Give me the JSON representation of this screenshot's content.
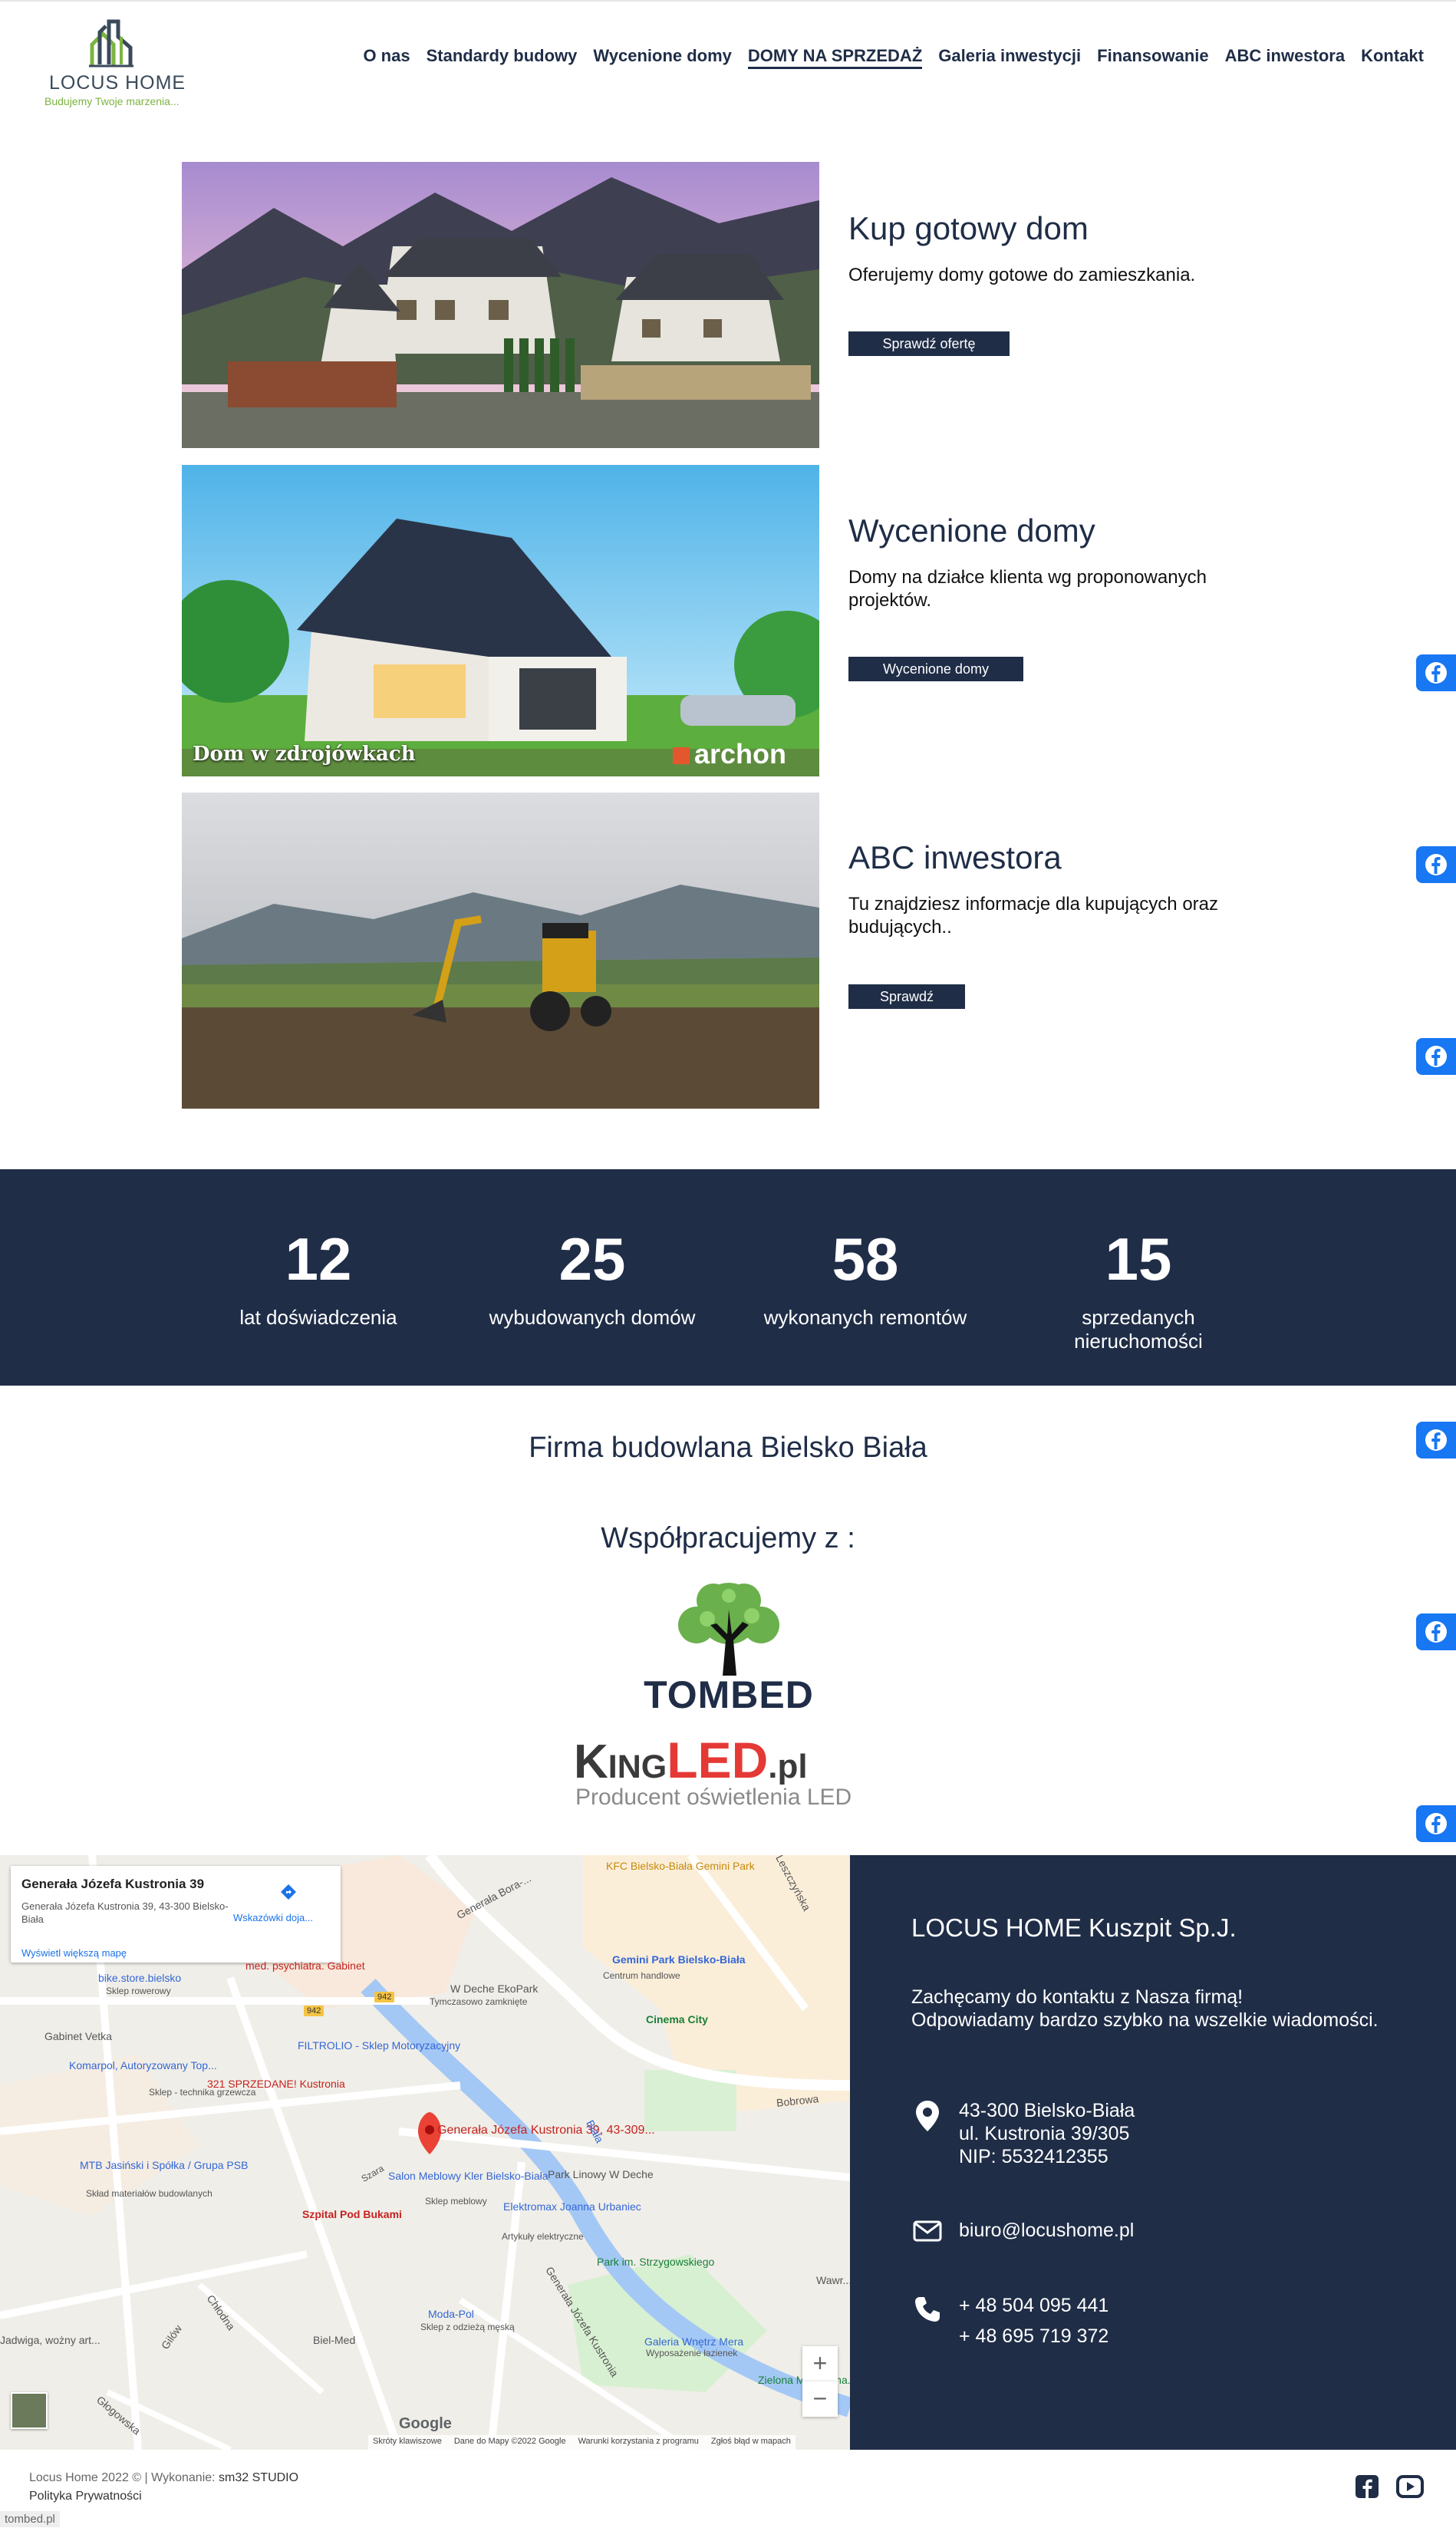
{
  "header": {
    "logo_name": "LOCUS HOME",
    "logo_slogan": "Budujemy Twoje marzenia...",
    "nav": [
      {
        "label": "O nas"
      },
      {
        "label": "Standardy budowy"
      },
      {
        "label": "Wycenione domy"
      },
      {
        "label": "DOMY NA SPRZEDAŻ",
        "active": true
      },
      {
        "label": "Galeria inwestycji"
      },
      {
        "label": "Finansowanie"
      },
      {
        "label": "ABC inwestora"
      },
      {
        "label": "Kontakt"
      }
    ]
  },
  "offers": [
    {
      "title": "Kup gotowy dom",
      "description": "Oferujemy domy gotowe do zamieszkania.",
      "button": "Sprawdź ofertę",
      "image": "houses-in-mountains"
    },
    {
      "title": "Wycenione domy",
      "description": "Domy na działce klienta wg proponowanych projektów.",
      "button": "Wycenione domy",
      "image": "house-render",
      "image_caption": "Dom w zdrojówkach",
      "image_brand": "archon"
    },
    {
      "title": "ABC inwestora",
      "description": "Tu znajdziesz informacje dla kupujących oraz budujących..",
      "button": "Sprawdź",
      "image": "excavator-on-plot"
    }
  ],
  "stats": [
    {
      "value": "12",
      "label": "lat doświadczenia"
    },
    {
      "value": "25",
      "label": "wybudowanych domów"
    },
    {
      "value": "58",
      "label": "wykonanych remontów"
    },
    {
      "value": "15",
      "label": "sprzedanych nieruchomości"
    }
  ],
  "about": {
    "heading": "Firma budowlana Bielsko Biała",
    "partners_heading": "Współpracujemy z :"
  },
  "partners": {
    "tombed": "TOMBED",
    "kingled_king": "King",
    "kingled_led": "LED",
    "kingled_pl": ".pl",
    "kingled_sub": "Producent oświetlenia LED"
  },
  "map": {
    "place_title": "Generała Józefa Kustronia 39",
    "place_address": "Generała Józefa Kustronia 39, 43-300 Bielsko-Biała",
    "directions": "Wskazówki doja...",
    "larger_map": "Wyświetl większą mapę",
    "pin_label": "Generała Józefa Kustronia 39, 43-309...",
    "labels": [
      "KFC Bielsko-Biała Gemini Park",
      "Gemini Park Bielsko-Biała",
      "Centrum handlowe",
      "Cinema City",
      "W Deche EkoPark",
      "Tymczasowo zamknięte",
      "bike.store.bielsko",
      "Sklep rowerowy",
      "Komarpol, Autoryzowany Top...",
      "Sklep - technika grzewcza",
      "321 SPRZEDANE! Kustronia",
      "FILTROLIO - Sklep Motoryzacyjny",
      "MTB Jasiński i Spółka / Grupa PSB",
      "Skład materiałów budowlanych",
      "Salon Meblowy Kler Bielsko-Biała",
      "Sklep meblowy",
      "Szpital Pod Bukami",
      "Park Linowy W Deche",
      "Elektromax Joanna Urbaniec",
      "Artykuły elektryczne",
      "Park im. Strzygowskiego",
      "Moda-Pol",
      "Sklep z odzieżą męską",
      "Biel-Med",
      "Galeria Wnętrz Mera",
      "Wyposażenie łazienek",
      "Zielona Miejska na...",
      "Generała Bora-...",
      "Leszczyńska",
      "Bobrowa",
      "Biała",
      "Szara",
      "Chłodna",
      "Głogowska",
      "Gilów",
      "Gabinet Vetka",
      "Generała Józefa Kustronia",
      "Jadwiga, wożny art...",
      "med. psychiatra. Gabinet",
      "Wawr..."
    ],
    "road_badges": [
      "942",
      "942"
    ],
    "footer_items": [
      "Skróty klawiszowe",
      "Dane do Mapy ©2022 Google",
      "Warunki korzystania z programu",
      "Zgłoś błąd w mapach"
    ],
    "google": "Google",
    "zoom_in": "+",
    "zoom_out": "−"
  },
  "contact": {
    "company": "LOCUS HOME Kuszpit Sp.J.",
    "intro_line1": "Zachęcamy do kontaktu z Nasza firmą!",
    "intro_line2": "Odpowiadamy bardzo szybko na wszelkie wiadomości.",
    "address_line1": "43-300 Bielsko-Biała",
    "address_line2": "ul. Kustronia 39/305",
    "address_line3": "NIP: 5532412355",
    "email": "biuro@locushome.pl",
    "phone1": "+ 48 504 095 441",
    "phone2": "+ 48 695 719 372"
  },
  "footer": {
    "copyright": "Locus Home 2022 © | Wykonanie:",
    "author": "sm32 STUDIO",
    "privacy": "Polityka Prywatności",
    "tombed_link": "tombed.pl"
  },
  "colors": {
    "navy": "#1f2d47",
    "facebook": "#1877f2",
    "logo_green": "#7cb342",
    "tombed_green": "#6ab04c",
    "kingled_red": "#e53935"
  }
}
